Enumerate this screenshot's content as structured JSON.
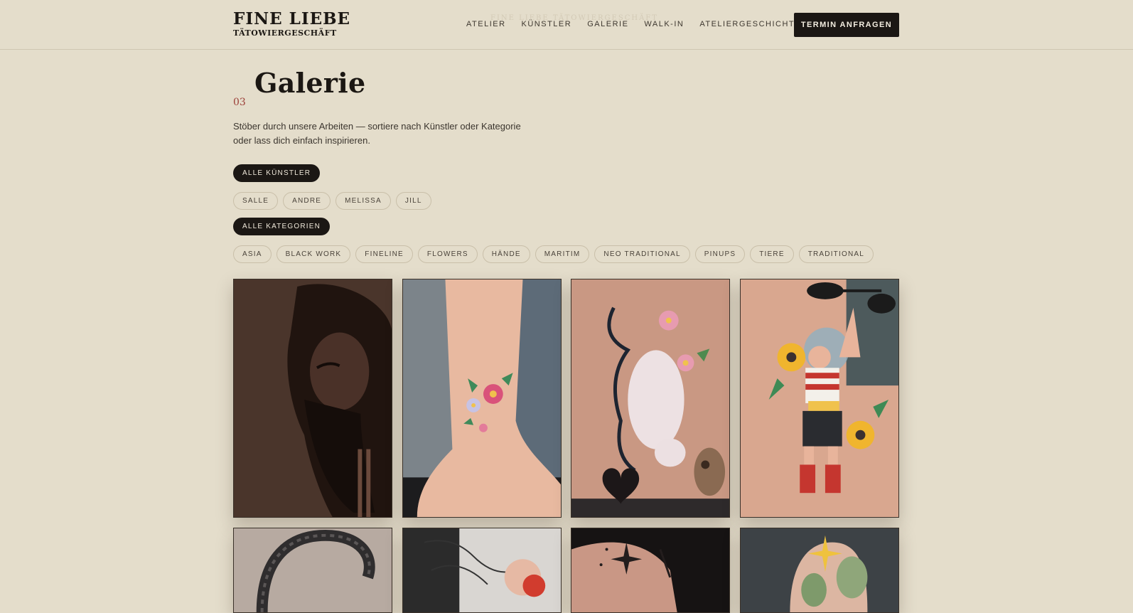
{
  "header": {
    "logo_main": "FINE LIEBE",
    "logo_sub": "TÄTOWIERGESCHÄFT",
    "ghost_title": "FINE LIEBE TÄTOWIERGESCHÄFT",
    "nav": [
      "ATELIER",
      "KÜNSTLER",
      "GALERIE",
      "WALK-IN",
      "ATELIERGESCHICHTEN"
    ],
    "cta_label": "TERMIN ANFRAGEN"
  },
  "section": {
    "number": "03",
    "title": "Galerie",
    "intro": "Stöber durch unsere Arbeiten — sortiere nach Künstler oder Kategorie oder lass dich einfach inspirieren."
  },
  "filters": {
    "artists_all": "ALLE KÜNSTLER",
    "artists": [
      "SALLE",
      "ANDRE",
      "MELISSA",
      "JILL"
    ],
    "categories_all": "ALLE KATEGORIEN",
    "categories": [
      "ASIA",
      "BLACK WORK",
      "FINELINE",
      "FLOWERS",
      "HÄNDE",
      "MARITIM",
      "NEO TRADITIONAL",
      "PINUPS",
      "TIERE",
      "TRADITIONAL"
    ]
  },
  "colors": {
    "background": "#e4ddcb",
    "accent_dark": "#1b1714",
    "section_number": "#9c3f38"
  }
}
